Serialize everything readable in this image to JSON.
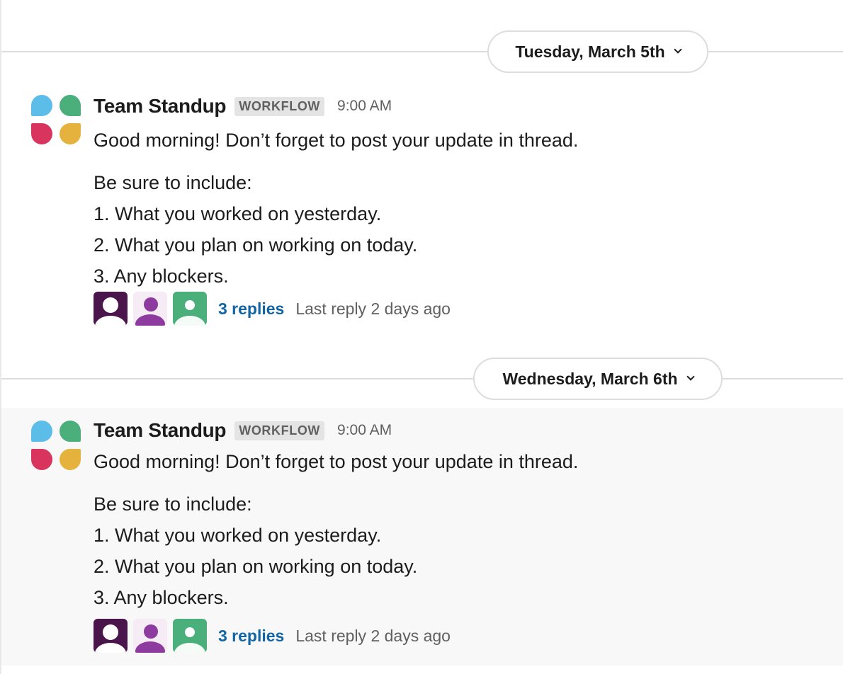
{
  "days": [
    {
      "label": "Tuesday, March 5th"
    },
    {
      "label": "Wednesday, March 6th"
    }
  ],
  "messages": [
    {
      "sender": "Team Standup",
      "badge": "WORKFLOW",
      "time": "9:00 AM",
      "intro": "Good morning! Don’t forget to post your update in thread.",
      "lines": [
        "Be sure to include:",
        "1. What you worked on yesterday.",
        "2. What you plan on working on today.",
        "3. Any blockers."
      ],
      "replies": "3 replies",
      "last_reply": "Last reply 2 days ago"
    },
    {
      "sender": "Team Standup",
      "badge": "WORKFLOW",
      "time": "9:00 AM",
      "intro": "Good morning! Don’t forget to post your update in thread.",
      "lines": [
        "Be sure to include:",
        "1. What you worked on yesterday.",
        "2. What you plan on working on today.",
        "3. Any blockers."
      ],
      "replies": "3 replies",
      "last_reply": "Last reply 2 days ago"
    }
  ],
  "icons": {
    "day_chevron": "chevron-down-icon",
    "app_logo": "workflow-app-icon"
  },
  "colors": {
    "link": "#1264a3",
    "logo_blue": "#5cbde8",
    "logo_green": "#4aaf7a",
    "logo_red": "#d9345e",
    "logo_yellow": "#e6b23e"
  }
}
